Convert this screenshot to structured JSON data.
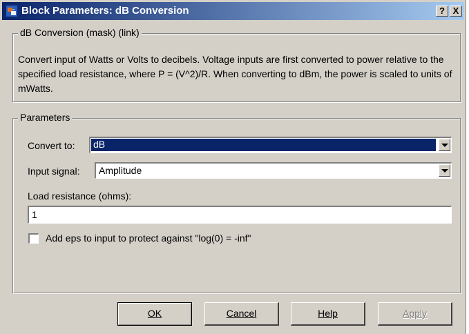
{
  "window": {
    "title": "Block Parameters: dB Conversion",
    "help_button": "?",
    "close_button": "X"
  },
  "mask": {
    "legend": "dB Conversion (mask) (link)",
    "description": "Convert input of Watts or Volts to decibels. Voltage inputs are first converted to power relative to the specified load resistance, where P = (V^2)/R.  When converting to dBm, the power is scaled to units of mWatts."
  },
  "parameters": {
    "legend": "Parameters",
    "convert_to": {
      "label": "Convert to:",
      "value": "dB"
    },
    "input_signal": {
      "label": "Input signal:",
      "value": "Amplitude"
    },
    "load_resistance": {
      "label": "Load resistance (ohms):",
      "value": "1"
    },
    "add_eps": {
      "label": "Add  eps to input to protect against  \"log(0) = -inf\"",
      "checked": false
    }
  },
  "buttons": {
    "ok": "OK",
    "cancel": "Cancel",
    "help": "Help",
    "apply": "Apply"
  },
  "colors": {
    "titlebar_start": "#0a246a",
    "titlebar_end": "#a6caf0",
    "dialog_bg": "#d4d0c8",
    "selection": "#0a246a"
  }
}
